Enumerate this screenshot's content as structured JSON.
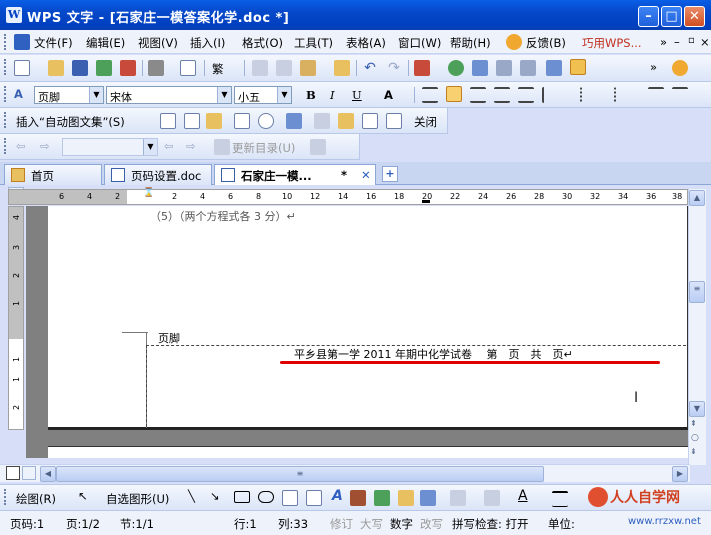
{
  "window": {
    "title": "WPS 文字 - [石家庄一模答案化学.doc *]",
    "logo": "W"
  },
  "menu": {
    "items": [
      "文件(F)",
      "编辑(E)",
      "视图(V)",
      "插入(I)",
      "格式(O)",
      "工具(T)",
      "表格(A)",
      "窗口(W)",
      "帮助(H)"
    ],
    "feedback": "反馈(B)",
    "promo": "巧用WPS..."
  },
  "format": {
    "style": "页脚",
    "font": "宋体",
    "size": "小五",
    "bold": "B",
    "italic": "I",
    "underline": "U",
    "fontcolor": "A"
  },
  "header_footer_bar": {
    "autotext": "插入“自动图文集”(S)",
    "close": "关闭"
  },
  "nav_bar": {
    "update_toc": "更新目录(U)"
  },
  "tabs": [
    {
      "label": "首页"
    },
    {
      "label": "页码设置.doc"
    },
    {
      "label": "石家庄一模...",
      "modified": "*",
      "close": "✕"
    }
  ],
  "ruler": {
    "h_labels": [
      "6",
      "4",
      "2",
      "2",
      "4",
      "6",
      "8",
      "10",
      "12",
      "14",
      "16",
      "18",
      "20",
      "22",
      "24",
      "26",
      "28",
      "30",
      "32",
      "34",
      "36",
      "38"
    ],
    "v_labels": [
      "4",
      "3",
      "2",
      "1",
      "1",
      "1",
      "2"
    ]
  },
  "document": {
    "prev_line": "（5）（两个方程式各 3 分）↵",
    "footer_label": "页脚",
    "footer_text": "平乡县第一学 2011 年期中化学试卷　 第　页　共　页↵",
    "underline_color": "#e00000"
  },
  "drawing": {
    "draw": "绘图(R)",
    "autoshape": "自选图形(U)"
  },
  "watermark": {
    "brand": "人人自学网",
    "url": "www.rrzxw.net"
  },
  "status": {
    "page": "页码:1",
    "pages": "页:1/2",
    "section": "节:1/1",
    "row": "行:1",
    "col": "列:33",
    "rev": "修订",
    "caps": "大写",
    "num": "数字",
    "ovr": "改写",
    "spell": "拼写检查: 打开",
    "unit": "单位:"
  }
}
